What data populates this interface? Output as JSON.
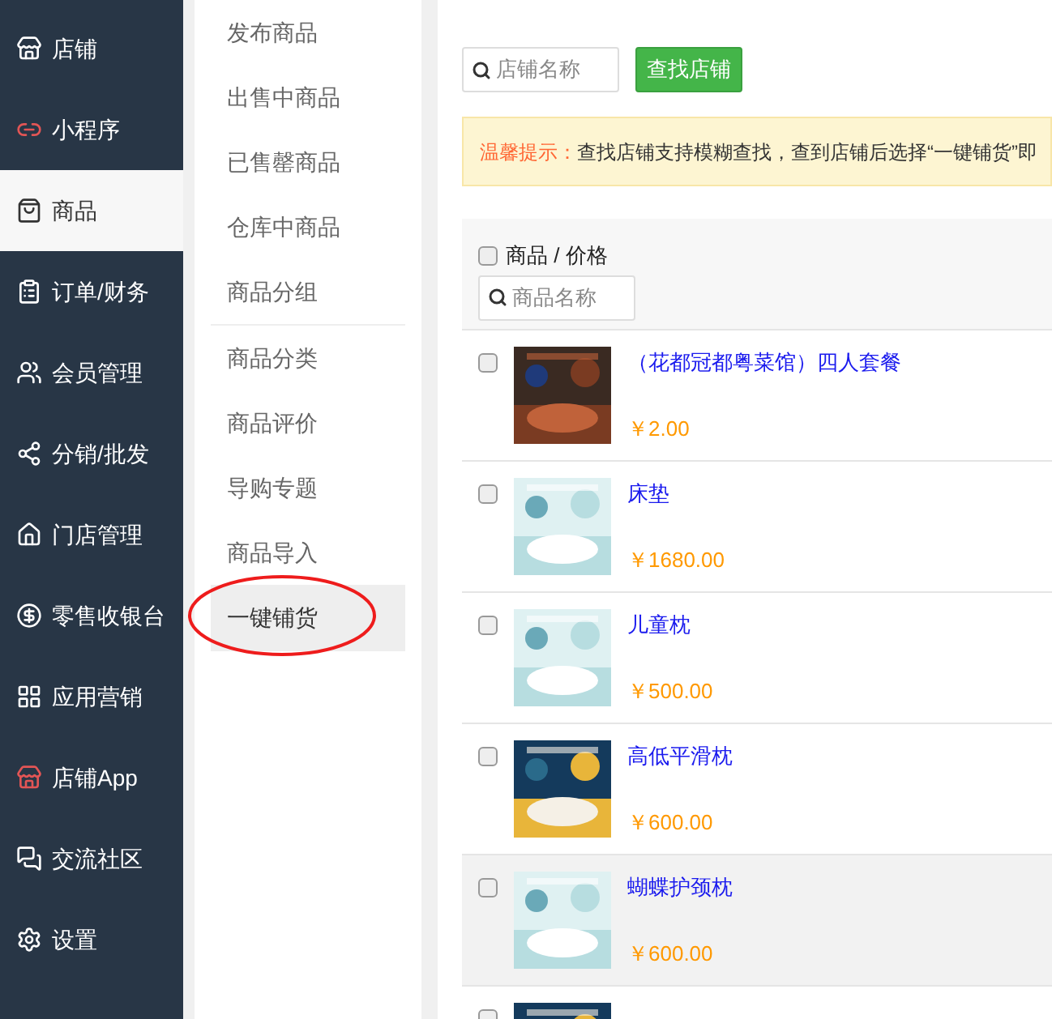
{
  "sidebar": {
    "items": [
      {
        "label": "店铺",
        "selected": false
      },
      {
        "label": "小程序",
        "selected": false
      },
      {
        "label": "商品",
        "selected": true
      },
      {
        "label": "订单/财务",
        "selected": false
      },
      {
        "label": "会员管理",
        "selected": false
      },
      {
        "label": "分销/批发",
        "selected": false
      },
      {
        "label": "门店管理",
        "selected": false
      },
      {
        "label": "零售收银台",
        "selected": false
      },
      {
        "label": "应用营销",
        "selected": false
      },
      {
        "label": "店铺App",
        "selected": false
      },
      {
        "label": "交流社区",
        "selected": false
      },
      {
        "label": "设置",
        "selected": false
      }
    ]
  },
  "submenu": {
    "groups": [
      [
        {
          "label": "发布商品",
          "selected": false
        },
        {
          "label": "出售中商品",
          "selected": false
        },
        {
          "label": "已售罄商品",
          "selected": false
        },
        {
          "label": "仓库中商品",
          "selected": false
        },
        {
          "label": "商品分组",
          "selected": false
        }
      ],
      [
        {
          "label": "商品分类",
          "selected": false
        },
        {
          "label": "商品评价",
          "selected": false
        },
        {
          "label": "导购专题",
          "selected": false
        },
        {
          "label": "商品导入",
          "selected": false
        },
        {
          "label": "一键铺货",
          "selected": true
        }
      ]
    ]
  },
  "search": {
    "placeholder": "店铺名称",
    "button": "查找店铺"
  },
  "notice": {
    "label": "温馨提示：",
    "text": "查找店铺支持模糊查找，查到店铺后选择“一键铺货”即"
  },
  "table": {
    "header": "商品 / 价格",
    "checked": false,
    "filter_placeholder": "商品名称",
    "rows": [
      {
        "title": "（花都冠都粤菜馆）四人套餐",
        "price": "￥2.00",
        "checked": false,
        "selected": false,
        "kind": "food"
      },
      {
        "title": "床垫",
        "price": "￥1680.00",
        "checked": false,
        "selected": false,
        "kind": "bedding"
      },
      {
        "title": "儿童枕",
        "price": "￥500.00",
        "checked": false,
        "selected": false,
        "kind": "bedding"
      },
      {
        "title": "高低平滑枕",
        "price": "￥600.00",
        "checked": false,
        "selected": false,
        "kind": "night"
      },
      {
        "title": "蝴蝶护颈枕",
        "price": "￥600.00",
        "checked": false,
        "selected": true,
        "kind": "bedding"
      },
      {
        "checked": false,
        "selected": false,
        "kind": "night"
      }
    ]
  }
}
